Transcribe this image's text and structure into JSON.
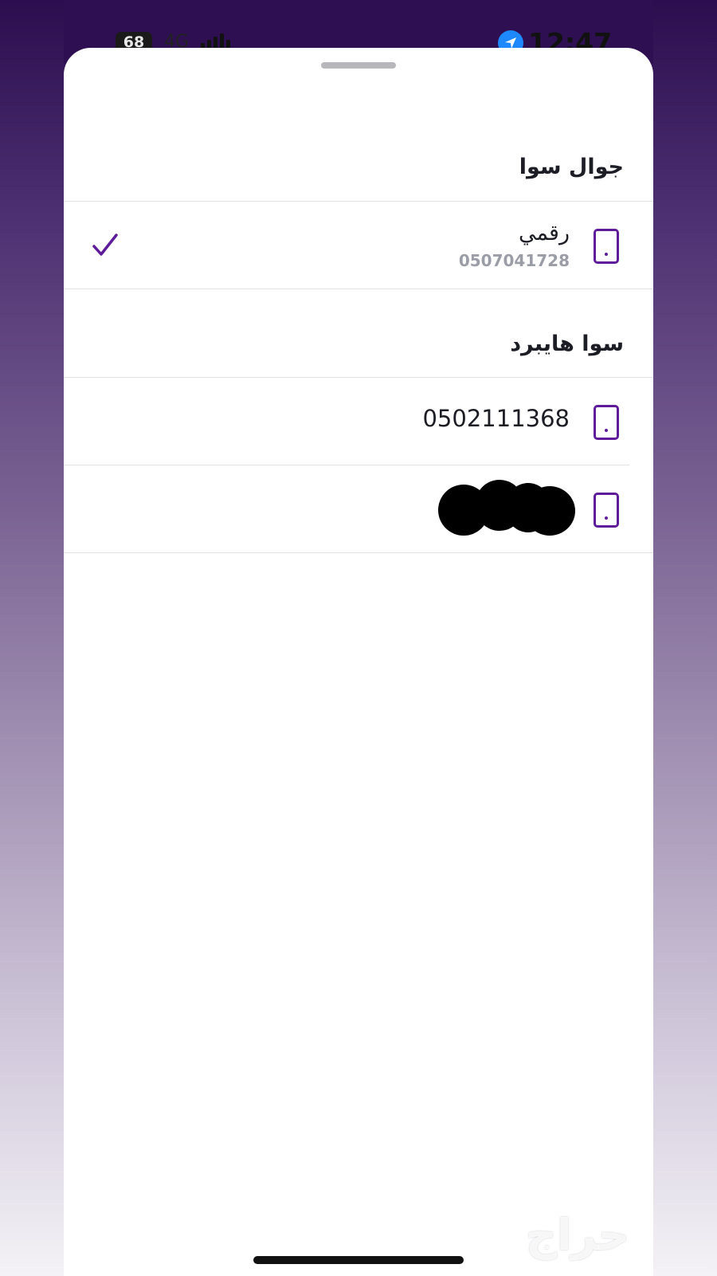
{
  "status_bar": {
    "battery": "68",
    "network": "4G",
    "time": "12:47"
  },
  "sheet": {
    "sections": [
      {
        "title": "جوال سوا",
        "items": [
          {
            "title": "رقمي",
            "number": "0507041728",
            "selected": true
          }
        ]
      },
      {
        "title": "سوا هايبرد",
        "items": [
          {
            "number": "0502111368",
            "selected": false
          },
          {
            "number": "",
            "redacted": true,
            "selected": false
          }
        ]
      }
    ]
  },
  "watermark": "حراج",
  "colors": {
    "accent": "#5e1c9a",
    "text": "#1d1d26",
    "muted": "#9a9ca6",
    "location_blue": "#1e88ff"
  },
  "icons": {
    "device": "phone-outline-icon",
    "selected": "checkmark-icon",
    "location": "location-arrow-icon"
  }
}
